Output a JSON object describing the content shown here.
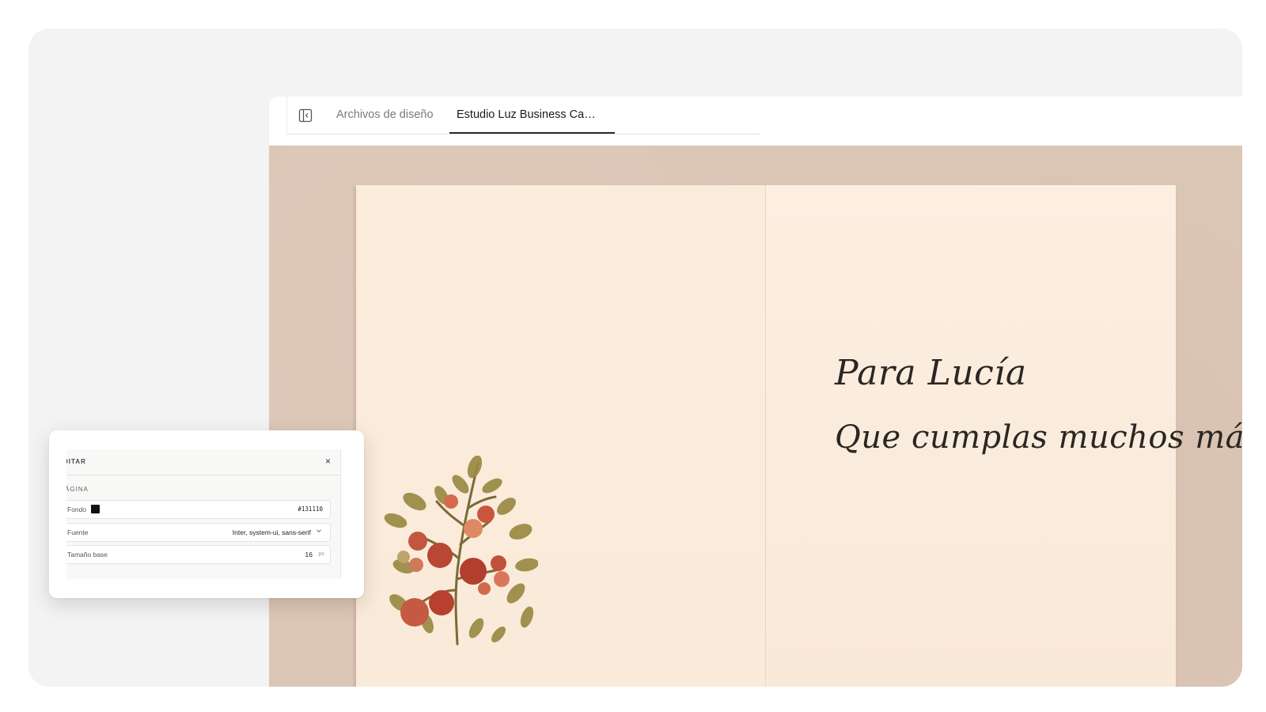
{
  "tabs": {
    "files_label": "Archivos de diseño",
    "active_label": "Estudio Luz Business Ca…"
  },
  "card": {
    "line1": "Para Lucía",
    "line2": "Que cumplas muchos más"
  },
  "edit_panel": {
    "title": "DITAR",
    "close_symbol": "×",
    "section_label": "ÁGINA",
    "background": {
      "label": "Fondo",
      "value": "#131110",
      "color": "#131110"
    },
    "font": {
      "label": "Fuente",
      "value": "Inter, system-ui, sans-serif"
    },
    "base_size": {
      "label": "Tamaño base",
      "value": "16",
      "unit": "px"
    }
  },
  "icons": {
    "sidebar_toggle": "sidebar-toggle-icon",
    "dropdown": "chevron-down-icon",
    "illustration": "tomato-plant-illustration"
  }
}
